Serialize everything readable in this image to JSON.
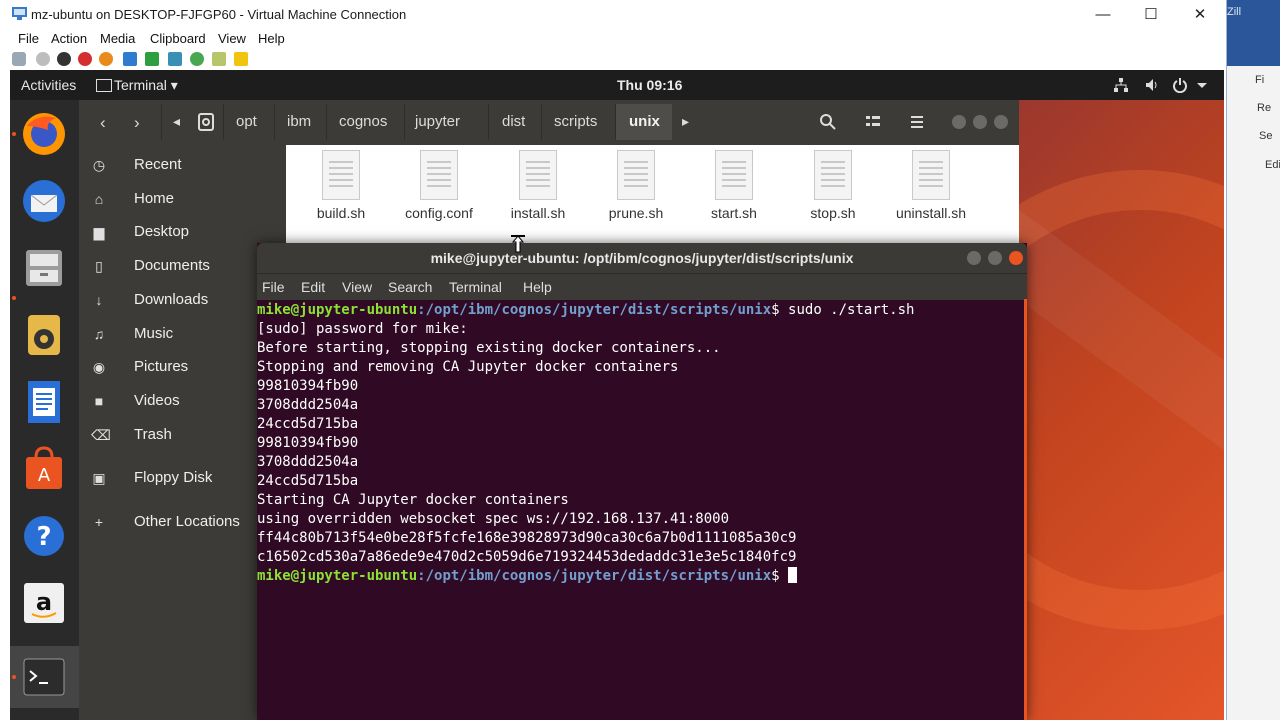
{
  "vm": {
    "title": "mz-ubuntu on DESKTOP-FJFGP60 - Virtual Machine Connection",
    "menu": [
      "File",
      "Action",
      "Media",
      "Clipboard",
      "View",
      "Help"
    ],
    "controls": {
      "minimize": "—",
      "maximize": "☐",
      "close": "✕"
    }
  },
  "host_right": {
    "top_text": "Zill",
    "items": [
      "Fi",
      "Re",
      "Se",
      "Edi"
    ]
  },
  "topbar": {
    "activities": "Activities",
    "app_menu": "Terminal",
    "app_menu_arrow": "▾",
    "clock": "Thu 09:16"
  },
  "dock": {
    "items": [
      "firefox-icon",
      "thunderbird-icon",
      "files-icon",
      "rhythmbox-icon",
      "writer-icon",
      "software-icon",
      "help-icon",
      "amazon-icon",
      "terminal-icon"
    ]
  },
  "files": {
    "breadcrumbs": [
      "opt",
      "ibm",
      "cognos",
      "jupyter",
      "dist",
      "scripts",
      "unix"
    ],
    "sidebar": [
      {
        "icon": "recent-icon",
        "label": "Recent"
      },
      {
        "icon": "home-icon",
        "label": "Home"
      },
      {
        "icon": "desktop-icon",
        "label": "Desktop"
      },
      {
        "icon": "documents-icon",
        "label": "Documents"
      },
      {
        "icon": "downloads-icon",
        "label": "Downloads"
      },
      {
        "icon": "music-icon",
        "label": "Music"
      },
      {
        "icon": "pictures-icon",
        "label": "Pictures"
      },
      {
        "icon": "videos-icon",
        "label": "Videos"
      },
      {
        "icon": "trash-icon",
        "label": "Trash"
      },
      {
        "icon": "floppy-icon",
        "label": "Floppy Disk"
      },
      {
        "icon": "plus-icon",
        "label": "Other Locations"
      }
    ],
    "files": [
      "build.sh",
      "config.conf",
      "install.sh",
      "prune.sh",
      "start.sh",
      "stop.sh",
      "uninstall.sh"
    ]
  },
  "terminal": {
    "title": "mike@jupyter-ubuntu: /opt/ibm/cognos/jupyter/dist/scripts/unix",
    "menu": [
      "File",
      "Edit",
      "View",
      "Search",
      "Terminal",
      "Help"
    ],
    "prompt_user": "mike@jupyter-ubuntu",
    "prompt_path": ":/opt/ibm/cognos/jupyter/dist/scripts/unix",
    "command": "$ sudo ./start.sh",
    "output": [
      "[sudo] password for mike:",
      "Before starting, stopping existing docker containers...",
      "Stopping and removing CA Jupyter docker containers",
      "99810394fb90",
      "3708ddd2504a",
      "24ccd5d715ba",
      "99810394fb90",
      "3708ddd2504a",
      "24ccd5d715ba",
      "Starting CA Jupyter docker containers",
      "using overridden websocket spec ws://192.168.137.41:8000",
      "ff44c80b713f54e0be28f5fcfe168e39828973d90ca30c6a7b0d1111085a30c9",
      "c16502cd530a7a86ede9e470d2c5059d6e719324453dedaddc31e3e5c1840fc9"
    ],
    "final_prompt_tail": "$ "
  }
}
